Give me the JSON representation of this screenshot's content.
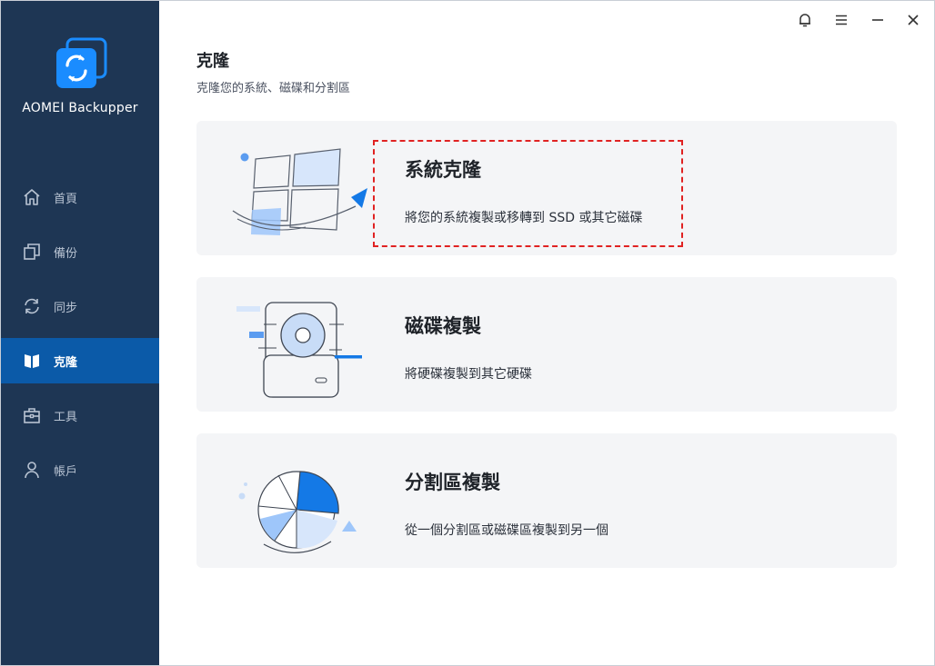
{
  "app": {
    "name": "AOMEI Backupper"
  },
  "sidebar": {
    "items": [
      {
        "label": "首頁",
        "icon": "home-icon",
        "active": false
      },
      {
        "label": "備份",
        "icon": "backup-icon",
        "active": false
      },
      {
        "label": "同步",
        "icon": "sync-icon",
        "active": false
      },
      {
        "label": "克隆",
        "icon": "clone-icon",
        "active": true
      },
      {
        "label": "工具",
        "icon": "tools-icon",
        "active": false
      },
      {
        "label": "帳戶",
        "icon": "user-icon",
        "active": false
      }
    ]
  },
  "window_controls": [
    "bell-icon",
    "menu-icon",
    "minimize-icon",
    "close-icon"
  ],
  "main": {
    "title": "克隆",
    "subtitle": "克隆您的系統、磁碟和分割區",
    "cards": [
      {
        "title": "系統克隆",
        "desc": "將您的系統複製或移轉到 SSD 或其它磁碟",
        "icon": "system-clone-illustration"
      },
      {
        "title": "磁碟複製",
        "desc": "將硬碟複製到其它硬碟",
        "icon": "disk-clone-illustration"
      },
      {
        "title": "分割區複製",
        "desc": "從一個分割區或磁碟區複製到另一個",
        "icon": "partition-clone-illustration"
      }
    ]
  },
  "colors": {
    "sidebar_bg": "#1e3654",
    "active_item": "#0b5aa8",
    "accent": "#1479e6",
    "card_bg": "#f4f5f7",
    "highlight": "#e02222"
  }
}
